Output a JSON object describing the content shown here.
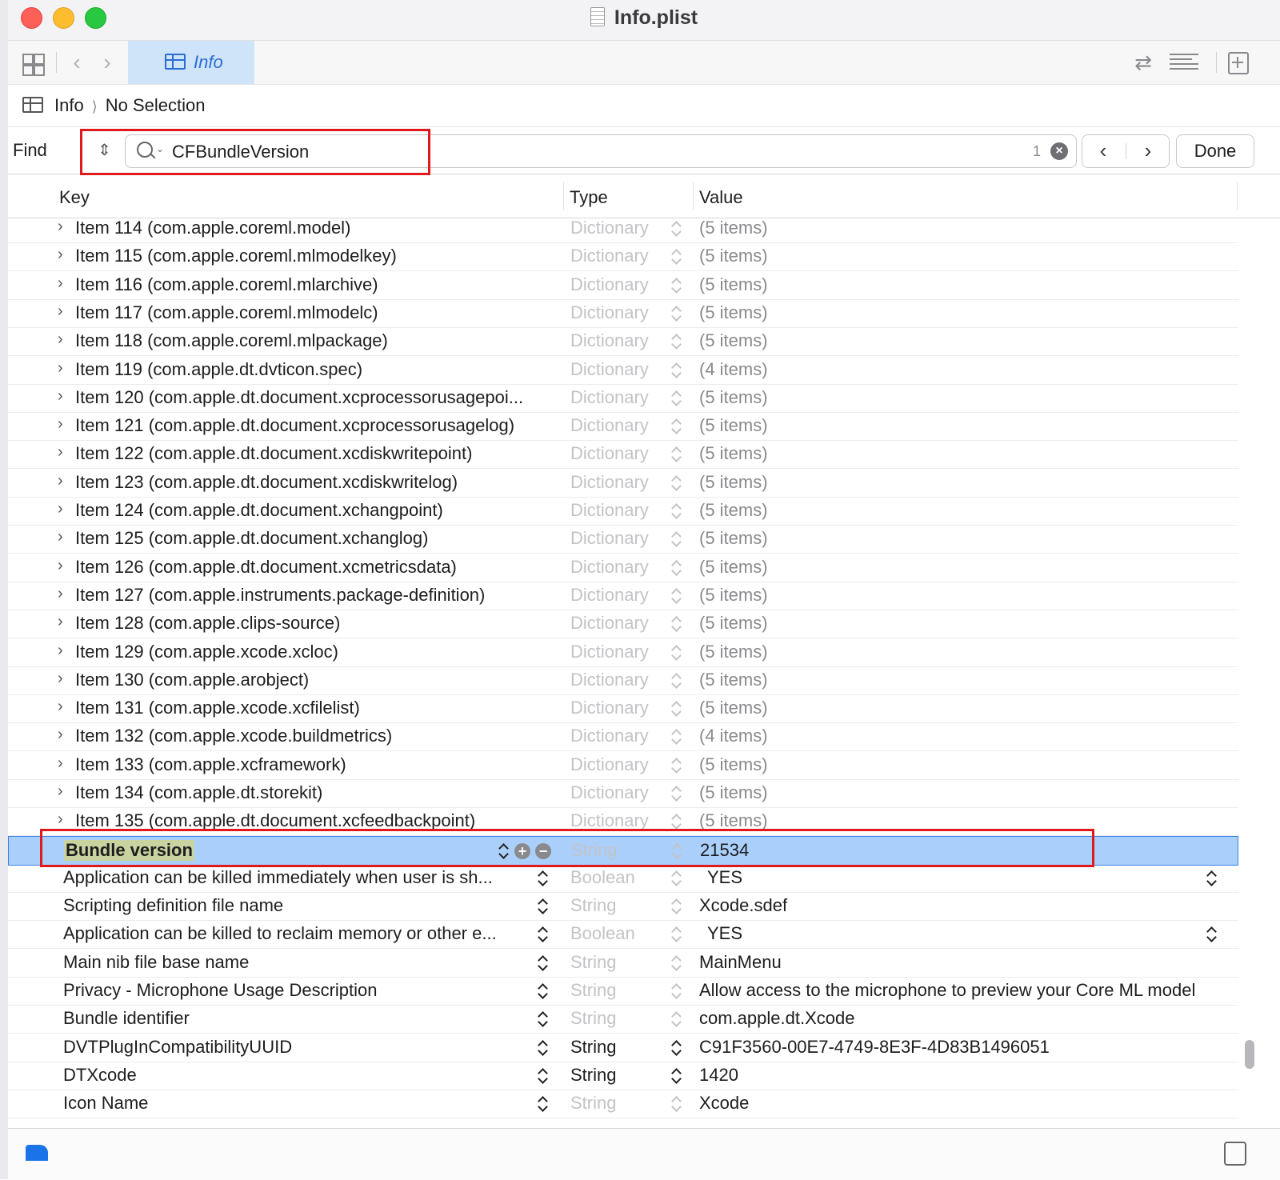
{
  "window": {
    "title": "Info.plist"
  },
  "toolbar": {
    "active_tab": "Info"
  },
  "jumpbar": {
    "root": "Info",
    "selection": "No Selection"
  },
  "find": {
    "label": "Find",
    "query": "CFBundleVersion",
    "match_count": "1",
    "done_label": "Done"
  },
  "table": {
    "columns": {
      "key": "Key",
      "type": "Type",
      "value": "Value"
    },
    "rows": [
      {
        "key": "Item 114 (com.apple.coreml.model)",
        "type": "Dictionary",
        "value": "(5 items)"
      },
      {
        "key": "Item 115 (com.apple.coreml.mlmodelkey)",
        "type": "Dictionary",
        "value": "(5 items)"
      },
      {
        "key": "Item 116 (com.apple.coreml.mlarchive)",
        "type": "Dictionary",
        "value": "(5 items)"
      },
      {
        "key": "Item 117 (com.apple.coreml.mlmodelc)",
        "type": "Dictionary",
        "value": "(5 items)"
      },
      {
        "key": "Item 118 (com.apple.coreml.mlpackage)",
        "type": "Dictionary",
        "value": "(5 items)"
      },
      {
        "key": "Item 119 (com.apple.dt.dvticon.spec)",
        "type": "Dictionary",
        "value": "(4 items)"
      },
      {
        "key": "Item 120 (com.apple.dt.document.xcprocessorusagepoi...",
        "type": "Dictionary",
        "value": "(5 items)"
      },
      {
        "key": "Item 121 (com.apple.dt.document.xcprocessorusagelog)",
        "type": "Dictionary",
        "value": "(5 items)"
      },
      {
        "key": "Item 122 (com.apple.dt.document.xcdiskwritepoint)",
        "type": "Dictionary",
        "value": "(5 items)"
      },
      {
        "key": "Item 123 (com.apple.dt.document.xcdiskwritelog)",
        "type": "Dictionary",
        "value": "(5 items)"
      },
      {
        "key": "Item 124 (com.apple.dt.document.xchangpoint)",
        "type": "Dictionary",
        "value": "(5 items)"
      },
      {
        "key": "Item 125 (com.apple.dt.document.xchanglog)",
        "type": "Dictionary",
        "value": "(5 items)"
      },
      {
        "key": "Item 126 (com.apple.dt.document.xcmetricsdata)",
        "type": "Dictionary",
        "value": "(5 items)"
      },
      {
        "key": "Item 127 (com.apple.instruments.package-definition)",
        "type": "Dictionary",
        "value": "(5 items)"
      },
      {
        "key": "Item 128 (com.apple.clips-source)",
        "type": "Dictionary",
        "value": "(5 items)"
      },
      {
        "key": "Item 129 (com.apple.xcode.xcloc)",
        "type": "Dictionary",
        "value": "(5 items)"
      },
      {
        "key": "Item 130 (com.apple.arobject)",
        "type": "Dictionary",
        "value": "(5 items)"
      },
      {
        "key": "Item 131 (com.apple.xcode.xcfilelist)",
        "type": "Dictionary",
        "value": "(5 items)"
      },
      {
        "key": "Item 132 (com.apple.xcode.buildmetrics)",
        "type": "Dictionary",
        "value": "(4 items)"
      },
      {
        "key": "Item 133 (com.apple.xcframework)",
        "type": "Dictionary",
        "value": "(5 items)"
      },
      {
        "key": "Item 134 (com.apple.dt.storekit)",
        "type": "Dictionary",
        "value": "(5 items)"
      },
      {
        "key": "Item 135 (com.apple.dt.document.xcfeedbackpoint)",
        "type": "Dictionary",
        "value": "(5 items)"
      },
      {
        "key": "Bundle version",
        "type": "String",
        "value": "21534"
      },
      {
        "key": "Application can be killed immediately when user is sh...",
        "type": "Boolean",
        "value": "YES"
      },
      {
        "key": "Scripting definition file name",
        "type": "String",
        "value": "Xcode.sdef"
      },
      {
        "key": "Application can be killed to reclaim memory or other e...",
        "type": "Boolean",
        "value": "YES"
      },
      {
        "key": "Main nib file base name",
        "type": "String",
        "value": "MainMenu"
      },
      {
        "key": "Privacy - Microphone Usage Description",
        "type": "String",
        "value": "Allow access to the microphone to preview your Core ML model"
      },
      {
        "key": "Bundle identifier",
        "type": "String",
        "value": "com.apple.dt.Xcode"
      },
      {
        "key": "DVTPlugInCompatibilityUUID",
        "type": "String",
        "value": "C91F3560-00E7-4749-8E3F-4D83B1496051"
      },
      {
        "key": "DTXcode",
        "type": "String",
        "value": "1420"
      },
      {
        "key": "Icon Name",
        "type": "String",
        "value": "Xcode"
      }
    ]
  }
}
